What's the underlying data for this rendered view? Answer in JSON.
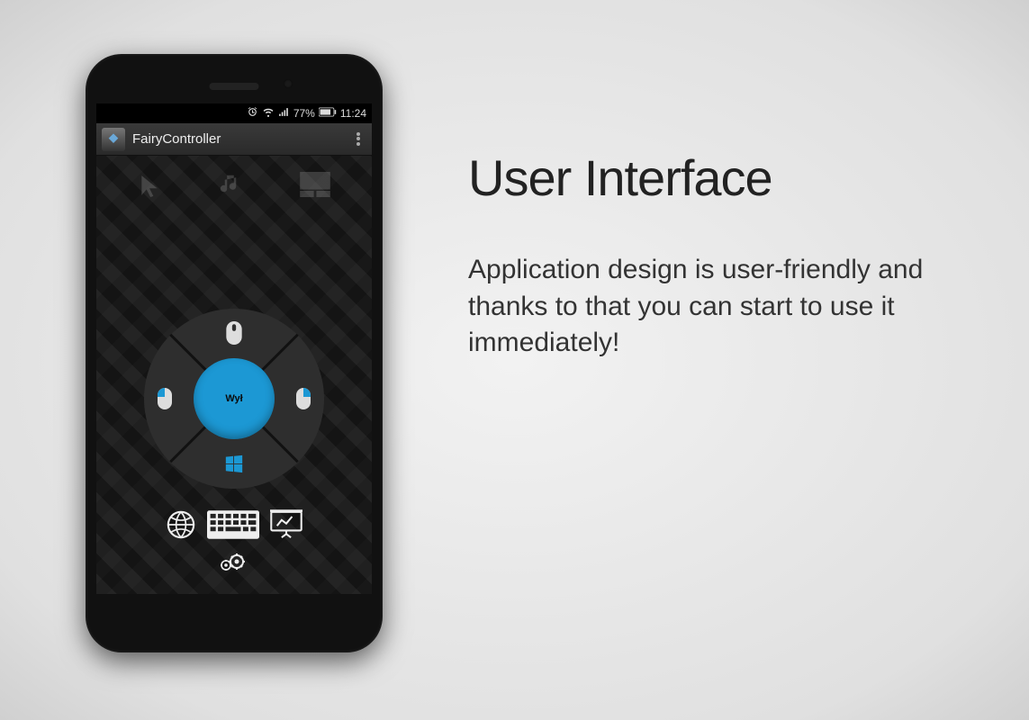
{
  "statusbar": {
    "battery_percent": "77%",
    "time": "11:24"
  },
  "appbar": {
    "title": "FairyController"
  },
  "controller": {
    "center_label": "Wył"
  },
  "icons": {
    "cursor": "cursor-icon",
    "music": "music-icon",
    "touchpad": "touchpad-icon",
    "mouse_top": "mouse-icon",
    "mouse_left": "mouse-icon",
    "mouse_right": "mouse-icon",
    "windows": "windows-icon",
    "globe": "globe-icon",
    "keyboard": "keyboard-icon",
    "presentation": "presentation-icon",
    "settings": "gear-icon"
  },
  "marketing": {
    "heading": "User Interface",
    "body": "Application design is user-friendly and thanks to that you can start to use it immediately!"
  }
}
